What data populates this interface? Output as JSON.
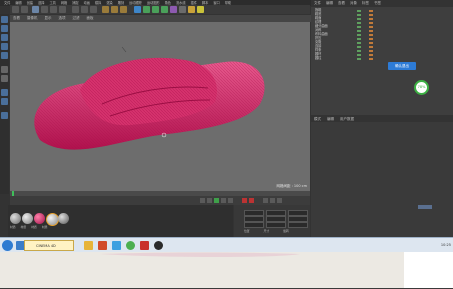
{
  "app": {
    "menu_items": [
      "文件",
      "编辑",
      "创建",
      "选择",
      "工具",
      "网格",
      "捕捉",
      "动画",
      "模拟",
      "渲染",
      "雕刻",
      "运动跟踪",
      "运动图形",
      "角色",
      "流水线",
      "插件",
      "脚本",
      "窗口",
      "帮助"
    ],
    "viewport_menu": [
      "查看",
      "摄像机",
      "显示",
      "选项",
      "过滤",
      "面板"
    ],
    "viewport_status": "网格间距 : 100 cm",
    "objmgr_tabs": [
      "文件",
      "编辑",
      "查看",
      "对象",
      "标签",
      "书签"
    ],
    "object_rows": [
      "拖鞋",
      "鞋底",
      "鞋面",
      "纹理",
      "细分曲面",
      "对称",
      "布料曲面",
      "挤压",
      "克隆",
      "连接",
      "样条",
      "圆环",
      "圆柱"
    ],
    "attr_tabs": [
      "模式",
      "编辑",
      "用户数据"
    ],
    "popup_button": "确认退出",
    "badge_text": "78%",
    "material_labels": [
      "材质",
      "材质",
      "材质",
      "材质"
    ],
    "coord_labels": [
      "位置",
      "尺寸",
      "旋转"
    ],
    "accent_color": "#e0356f",
    "brand_color": "#2d7bd6"
  },
  "taskbar": {
    "active_window_label": "CINEMA 4D",
    "clock": "10:25",
    "icons": [
      "start-icon",
      "ie-icon",
      "explorer-icon",
      "media-icon",
      "qq-icon",
      "chrome-icon",
      "pdf-icon",
      "c4d-icon"
    ]
  }
}
